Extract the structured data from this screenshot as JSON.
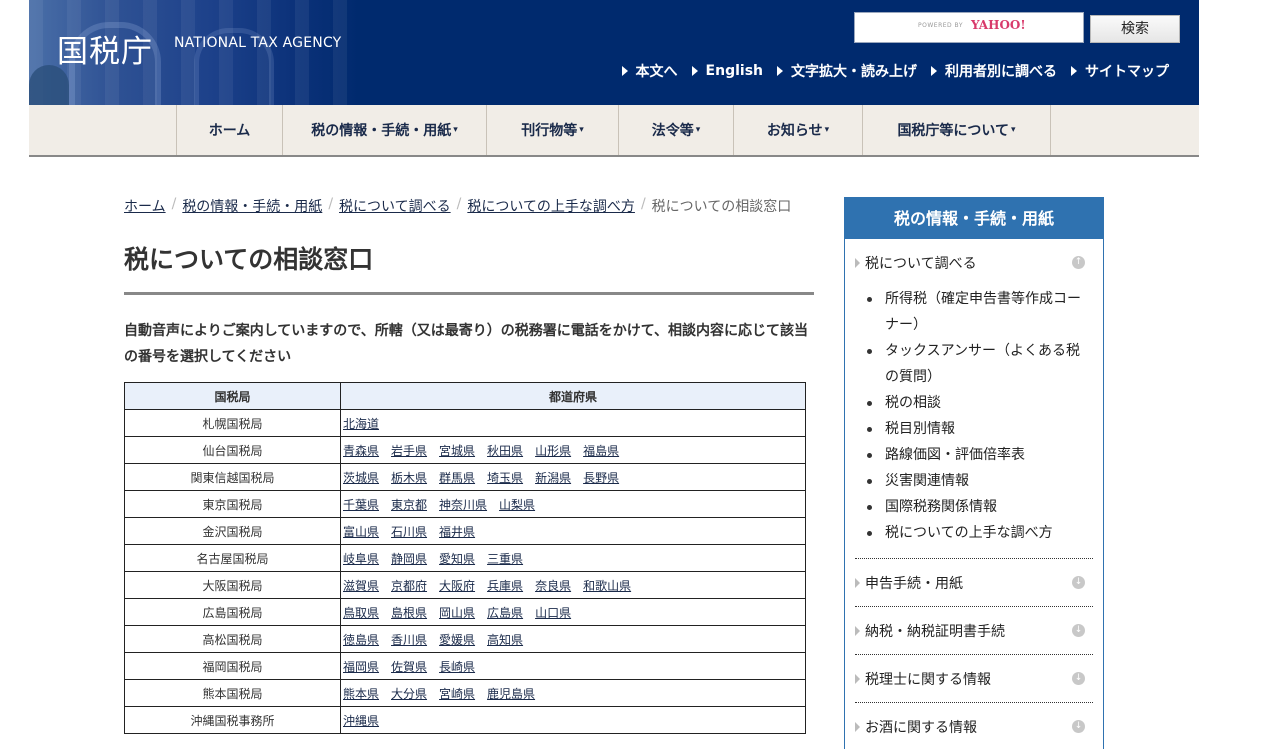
{
  "header": {
    "logo_jp": "国税庁",
    "logo_en": "NATIONAL TAX AGENCY",
    "search": {
      "value": "",
      "powered_by": "POWERED BY",
      "provider": "YAHOO!",
      "button_label": "検索"
    },
    "util_links": [
      "本文へ",
      "English",
      "文字拡大・読み上げ",
      "利用者別に調べる",
      "サイトマップ"
    ]
  },
  "global_nav": [
    {
      "label": "ホーム",
      "caret": ""
    },
    {
      "label": "税の情報・手続・用紙",
      "caret": "▾"
    },
    {
      "label": "刊行物等",
      "caret": "▾"
    },
    {
      "label": "法令等",
      "caret": "▾"
    },
    {
      "label": "お知らせ",
      "caret": "▾"
    },
    {
      "label": "国税庁等について",
      "caret": "▾"
    }
  ],
  "breadcrumb": {
    "links": [
      "ホーム",
      "税の情報・手続・用紙",
      "税について調べる",
      "税についての上手な調べ方"
    ],
    "separator": "/",
    "current": "税についての相談窓口"
  },
  "page_title": "税についての相談窓口",
  "intro": "自動音声によりご案内していますので、所轄（又は最寄り）の税務署に電話をかけて、相談内容に応じて該当の番号を選択してください",
  "table": {
    "headers": [
      "国税局",
      "都道府県"
    ],
    "rows": [
      {
        "bureau": "札幌国税局",
        "prefs": [
          "北海道"
        ]
      },
      {
        "bureau": "仙台国税局",
        "prefs": [
          "青森県",
          "岩手県",
          "宮城県",
          "秋田県",
          "山形県",
          "福島県"
        ]
      },
      {
        "bureau": "関東信越国税局",
        "prefs": [
          "茨城県",
          "栃木県",
          "群馬県",
          "埼玉県",
          "新潟県",
          "長野県"
        ]
      },
      {
        "bureau": "東京国税局",
        "prefs": [
          "千葉県",
          "東京都",
          "神奈川県",
          "山梨県"
        ]
      },
      {
        "bureau": "金沢国税局",
        "prefs": [
          "富山県",
          "石川県",
          "福井県"
        ]
      },
      {
        "bureau": "名古屋国税局",
        "prefs": [
          "岐阜県",
          "静岡県",
          "愛知県",
          "三重県"
        ]
      },
      {
        "bureau": "大阪国税局",
        "prefs": [
          "滋賀県",
          "京都府",
          "大阪府",
          "兵庫県",
          "奈良県",
          "和歌山県"
        ]
      },
      {
        "bureau": "広島国税局",
        "prefs": [
          "鳥取県",
          "島根県",
          "岡山県",
          "広島県",
          "山口県"
        ]
      },
      {
        "bureau": "高松国税局",
        "prefs": [
          "徳島県",
          "香川県",
          "愛媛県",
          "高知県"
        ]
      },
      {
        "bureau": "福岡国税局",
        "prefs": [
          "福岡県",
          "佐賀県",
          "長崎県"
        ]
      },
      {
        "bureau": "熊本国税局",
        "prefs": [
          "熊本県",
          "大分県",
          "宮崎県",
          "鹿児島県"
        ]
      },
      {
        "bureau": "沖縄国税事務所",
        "prefs": [
          "沖縄県"
        ]
      }
    ]
  },
  "sidebar": {
    "title": "税の情報・手続・用紙",
    "sections": [
      {
        "label": "税について調べる",
        "icon": "arrow-up-circle-icon",
        "expanded": true,
        "items": [
          "所得税（確定申告書等作成コーナー）",
          "タックスアンサー（よくある税の質問）",
          "税の相談",
          "税目別情報",
          "路線価図・評価倍率表",
          "災害関連情報",
          "国際税務関係情報",
          "税についての上手な調べ方"
        ]
      },
      {
        "label": "申告手続・用紙",
        "icon": "arrow-down-circle-icon",
        "expanded": false,
        "items": []
      },
      {
        "label": "納税・納税証明書手続",
        "icon": "arrow-down-circle-icon",
        "expanded": false,
        "items": []
      },
      {
        "label": "税理士に関する情報",
        "icon": "arrow-down-circle-icon",
        "expanded": false,
        "items": []
      },
      {
        "label": "お酒に関する情報",
        "icon": "arrow-down-circle-icon",
        "expanded": false,
        "items": []
      }
    ]
  },
  "colors": {
    "header_bg": "#002a6e",
    "nav_bg": "#f1ede7",
    "sidebar_accent": "#2f72b0",
    "table_header_bg": "#e9f0fa",
    "link": "#1a2a4a"
  }
}
